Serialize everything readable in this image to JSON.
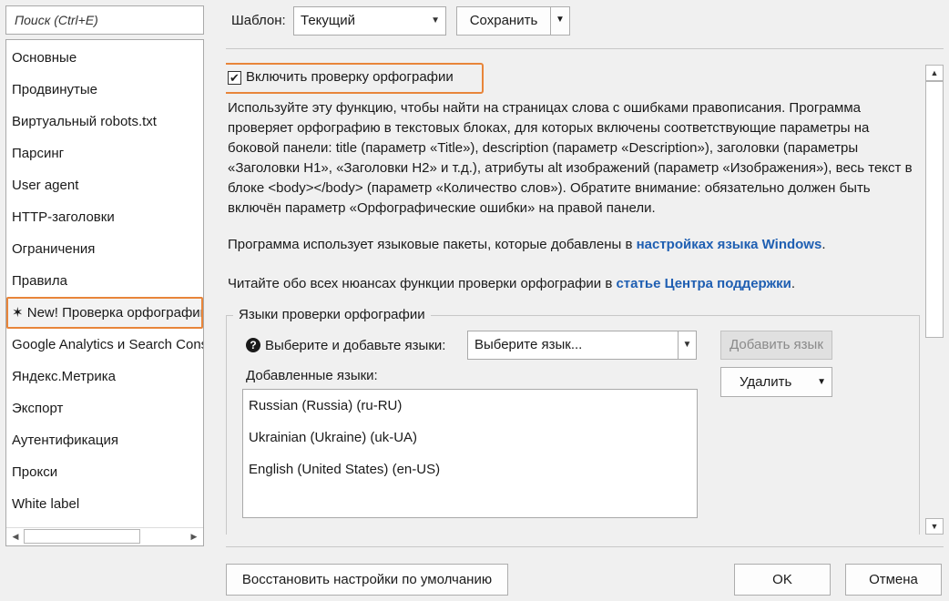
{
  "search": {
    "placeholder": "Поиск (Ctrl+E)"
  },
  "sidebar": {
    "items": [
      {
        "label": "Основные"
      },
      {
        "label": "Продвинутые"
      },
      {
        "label": "Виртуальный robots.txt"
      },
      {
        "label": "Парсинг"
      },
      {
        "label": "User agent"
      },
      {
        "label": "HTTP-заголовки"
      },
      {
        "label": "Ограничения"
      },
      {
        "label": "Правила"
      },
      {
        "label": "✶ New! Проверка орфографии",
        "selected": true
      },
      {
        "label": "Google Analytics и Search Console"
      },
      {
        "label": "Яндекс.Метрика"
      },
      {
        "label": "Экспорт"
      },
      {
        "label": "Аутентификация"
      },
      {
        "label": "Прокси"
      },
      {
        "label": "White label"
      }
    ]
  },
  "toolbar": {
    "template_label": "Шаблон:",
    "template_value": "Текущий",
    "save_label": "Сохранить"
  },
  "spellcheck": {
    "enable_label": "Включить проверку орфографии",
    "enabled": true,
    "description": "Используйте эту функцию, чтобы найти на страницах слова с ошибками правописания. Программа проверяет орфографию в текстовых блоках, для которых включены соответствующие параметры на боковой панели: title (параметр «Title»), description (параметр «Description»), заголовки (параметры «Заголовки H1», «Заголовки H2» и т.д.), атрибуты alt изображений (параметр «Изображения»), весь текст в блоке <body></body> (параметр «Количество слов»). Обратите внимание: обязательно должен быть включён параметр «Орфографические ошибки» на правой панели.",
    "lang_packs_text": "Программа использует языковые пакеты, которые добавлены в ",
    "lang_packs_link": "настройках языка Windows",
    "lang_packs_end": ".",
    "help_text": "Читайте обо всех нюансах функции проверки орфографии в ",
    "help_link": "статье Центра поддержки",
    "help_end": "."
  },
  "languages": {
    "group_title": "Языки проверки орфографии",
    "help_icon": "question-circle-icon",
    "select_label": "Выберите и добавьте языки:",
    "select_placeholder": "Выберите язык...",
    "add_button": "Добавить язык",
    "added_label": "Добавленные языки:",
    "delete_button": "Удалить",
    "items": [
      {
        "label": "Russian (Russia) (ru-RU)"
      },
      {
        "label": "Ukrainian (Ukraine) (uk-UA)"
      },
      {
        "label": "English (United States) (en-US)"
      }
    ]
  },
  "footer": {
    "reset_label": "Восстановить настройки по умолчанию",
    "ok_label": "OK",
    "cancel_label": "Отмена"
  },
  "colors": {
    "highlight": "#e8853a",
    "link": "#1f5fb2"
  }
}
